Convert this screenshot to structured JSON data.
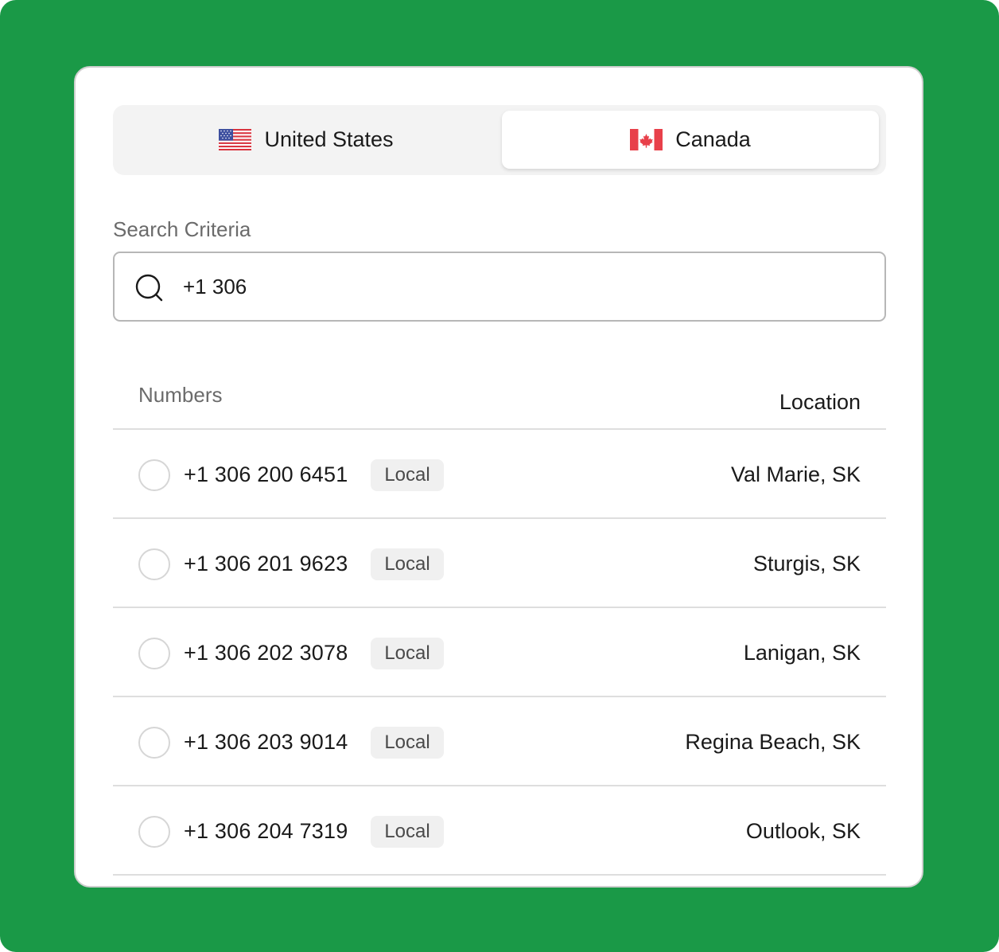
{
  "colors": {
    "background_green": "#1a9947",
    "card": "#ffffff",
    "segment_bg": "#f3f3f3",
    "muted_text": "#6b6b6b",
    "badge_bg": "#f0f0f0"
  },
  "country_tabs": [
    {
      "label": "United States",
      "icon": "us-flag-icon",
      "selected": false
    },
    {
      "label": "Canada",
      "icon": "canada-flag-icon",
      "selected": true
    }
  ],
  "search": {
    "label": "Search Criteria",
    "value": "+1 306",
    "icon": "search-icon"
  },
  "table": {
    "headers": {
      "numbers": "Numbers",
      "location": "Location"
    },
    "rows": [
      {
        "number": "+1 306 200 6451",
        "type": "Local",
        "location": "Val Marie, SK"
      },
      {
        "number": "+1 306 201 9623",
        "type": "Local",
        "location": "Sturgis, SK"
      },
      {
        "number": "+1 306 202 3078",
        "type": "Local",
        "location": "Lanigan, SK"
      },
      {
        "number": "+1 306 203 9014",
        "type": "Local",
        "location": "Regina Beach, SK"
      },
      {
        "number": "+1 306 204 7319",
        "type": "Local",
        "location": "Outlook, SK"
      }
    ]
  }
}
